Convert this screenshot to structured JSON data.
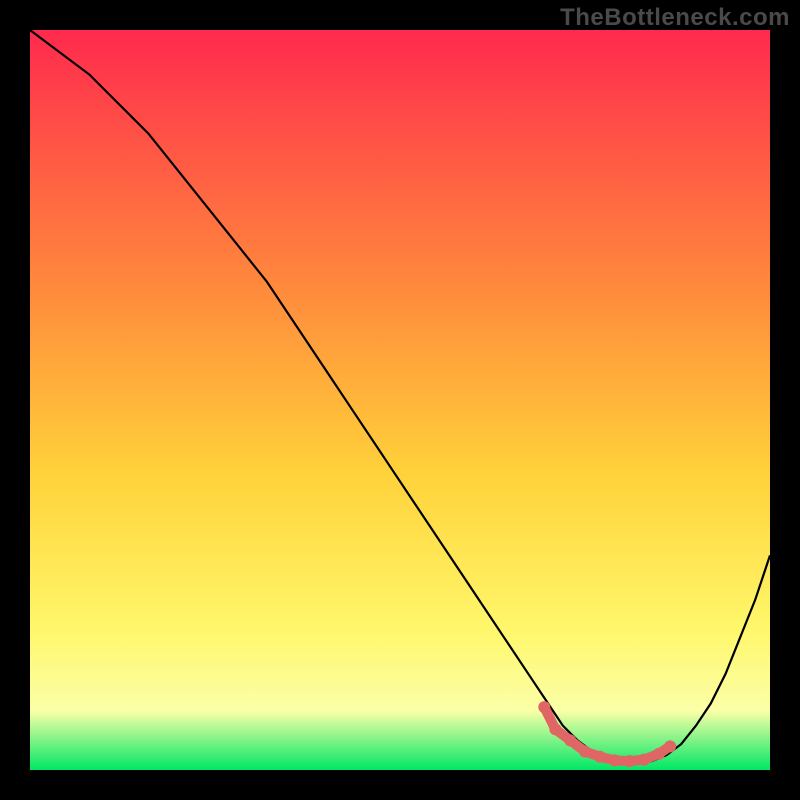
{
  "watermark": "TheBottleneck.com",
  "colors": {
    "gradient_top": "#ff2a4d",
    "gradient_mid1": "#ff8a3c",
    "gradient_mid2": "#ffd23a",
    "gradient_mid3": "#fff76b",
    "gradient_mid4": "#fbffa7",
    "gradient_bot": "#00e765",
    "curve": "#000000",
    "marker": "#e06666",
    "frame": "#000000"
  },
  "chart_data": {
    "type": "line",
    "title": "",
    "xlabel": "",
    "ylabel": "",
    "xlim": [
      0,
      100
    ],
    "ylim": [
      0,
      100
    ],
    "series": [
      {
        "name": "bottleneck-curve",
        "x": [
          0,
          4,
          8,
          12,
          16,
          20,
          24,
          28,
          32,
          36,
          40,
          44,
          48,
          52,
          56,
          60,
          64,
          68,
          70,
          72,
          74,
          76,
          78,
          80,
          82,
          84,
          86,
          88,
          90,
          92,
          94,
          96,
          98,
          100
        ],
        "y": [
          100,
          97,
          94,
          90,
          86,
          81,
          76,
          71,
          66,
          60,
          54,
          48,
          42,
          36,
          30,
          24,
          18,
          12,
          9,
          6,
          4,
          2.5,
          1.5,
          1,
          1,
          1.2,
          2,
          3.5,
          6,
          9,
          13,
          18,
          23,
          29
        ]
      },
      {
        "name": "optimal-zone-markers",
        "x": [
          69.5,
          71,
          73,
          75,
          77,
          79,
          81,
          83,
          85,
          86.5
        ],
        "y": [
          8.5,
          5.5,
          4,
          2.5,
          1.8,
          1.3,
          1.2,
          1.4,
          2.2,
          3.2
        ]
      }
    ],
    "annotations": []
  }
}
